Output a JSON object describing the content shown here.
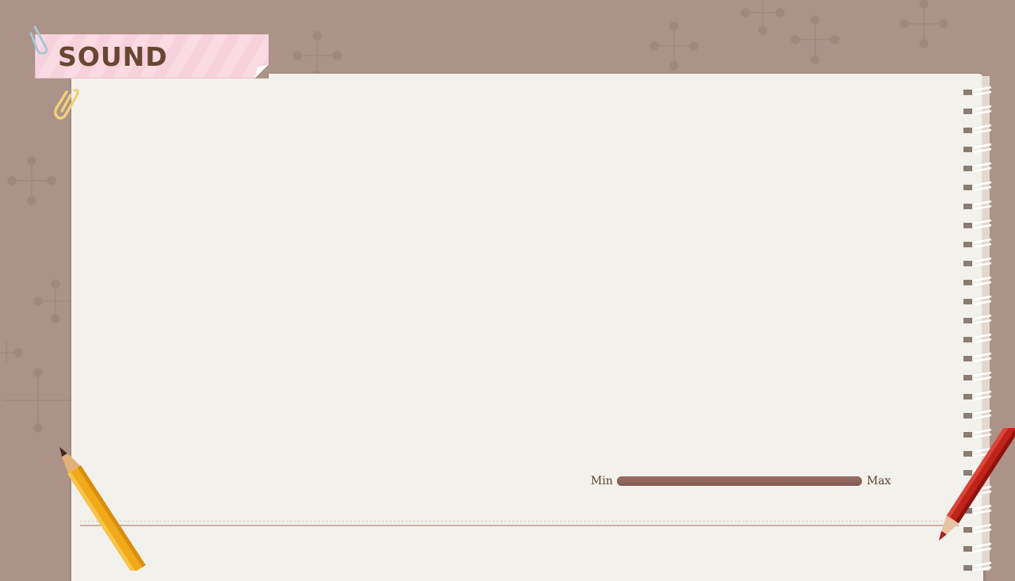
{
  "screen": {
    "title": "SOUND"
  },
  "volume": {
    "min_label": "Min",
    "max_label": "Max",
    "level": 1.0
  },
  "colors": {
    "background": "#ac938a",
    "paper": "#f2f1ec",
    "title_tape": "#fadbe4",
    "title_text": "#6a4632",
    "slider_track": "#8b6258"
  },
  "icons": {
    "top_clip": "paperclip-blue-icon",
    "side_clip": "paperclip-yellow-icon",
    "left_pencil": "yellow-pencil-icon",
    "right_pencil": "red-pencil-icon"
  }
}
